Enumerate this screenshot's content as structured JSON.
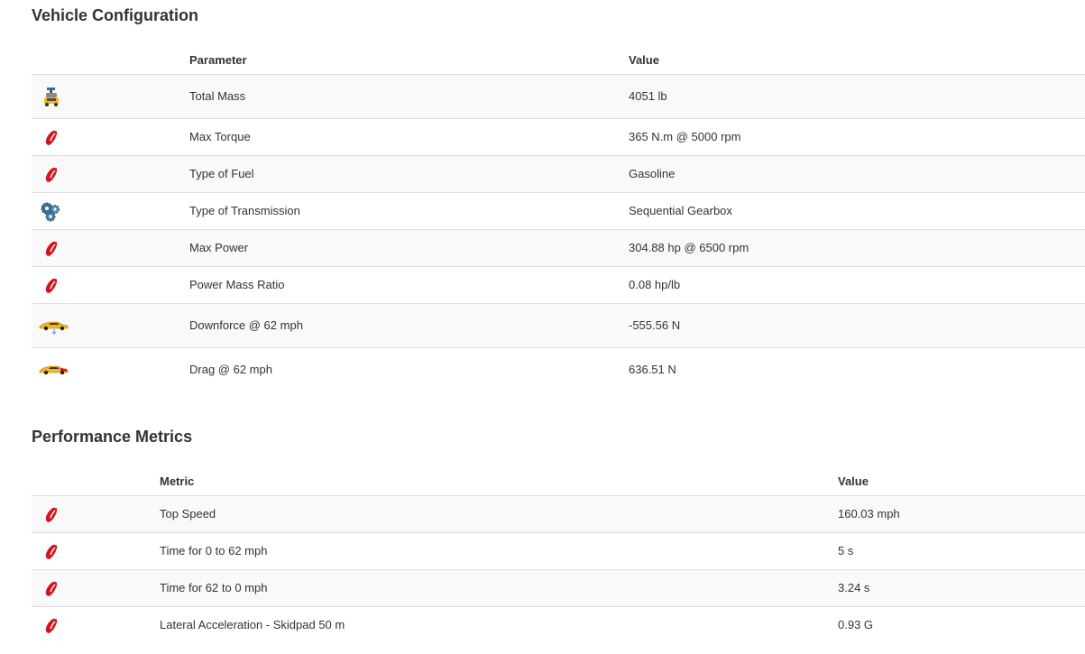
{
  "vehicle": {
    "title": "Vehicle Configuration",
    "headers": {
      "parameter": "Parameter",
      "value": "Value"
    },
    "rows": [
      {
        "icon": "car-weight-icon",
        "parameter": "Total Mass",
        "value": "4051 lb"
      },
      {
        "icon": "pepper-icon",
        "parameter": "Max Torque",
        "value": "365 N.m @ 5000 rpm"
      },
      {
        "icon": "pepper-icon",
        "parameter": "Type of Fuel",
        "value": "Gasoline"
      },
      {
        "icon": "gears-icon",
        "parameter": "Type of Transmission",
        "value": "Sequential Gearbox"
      },
      {
        "icon": "pepper-icon",
        "parameter": "Max Power",
        "value": "304.88 hp @ 6500 rpm"
      },
      {
        "icon": "pepper-icon",
        "parameter": "Power Mass Ratio",
        "value": "0.08 hp/lb"
      },
      {
        "icon": "car-downforce-icon",
        "parameter": "Downforce @ 62 mph",
        "value": "-555.56 N"
      },
      {
        "icon": "car-drag-icon",
        "parameter": "Drag @ 62 mph",
        "value": "636.51 N"
      }
    ]
  },
  "performance": {
    "title": "Performance Metrics",
    "headers": {
      "metric": "Metric",
      "value": "Value"
    },
    "rows": [
      {
        "icon": "pepper-icon",
        "metric": "Top Speed",
        "value": "160.03 mph"
      },
      {
        "icon": "pepper-icon",
        "metric": "Time for 0 to 62 mph",
        "value": "5 s"
      },
      {
        "icon": "pepper-icon",
        "metric": "Time for 62 to 0 mph",
        "value": "3.24 s"
      },
      {
        "icon": "pepper-icon",
        "metric": "Lateral Acceleration - Skidpad 50 m",
        "value": "0.93 G"
      }
    ]
  },
  "colors": {
    "accent_red": "#d2161f",
    "car_yellow": "#f2b81b",
    "row_stripe": "#f9f9f9",
    "border": "#dddddd"
  }
}
